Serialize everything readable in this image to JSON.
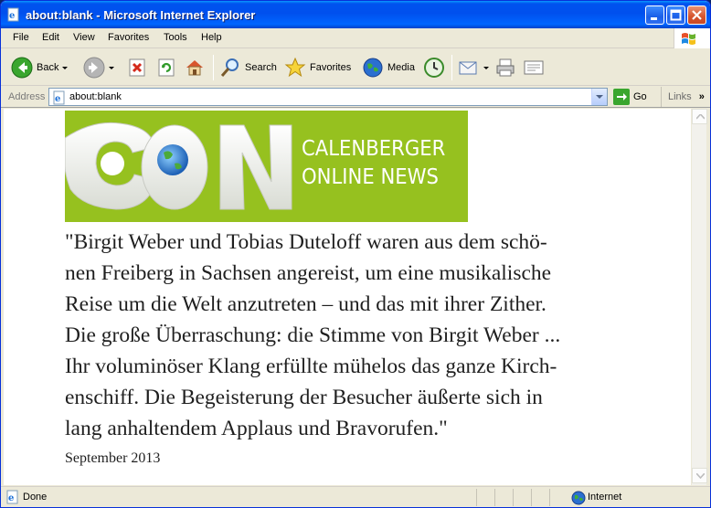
{
  "window": {
    "title": "about:blank - Microsoft Internet Explorer"
  },
  "menu": {
    "items": [
      "File",
      "Edit",
      "View",
      "Favorites",
      "Tools",
      "Help"
    ]
  },
  "toolbar": {
    "back_label": "Back",
    "search_label": "Search",
    "favorites_label": "Favorites",
    "media_label": "Media"
  },
  "address": {
    "label": "Address",
    "value": "about:blank",
    "go_label": "Go",
    "links_label": "Links"
  },
  "content": {
    "banner": {
      "line1": "CALENBERGER",
      "line2": "ONLINE NEWS",
      "brand_color": "#96c11f"
    },
    "quote_lines": [
      "\"Birgit Weber und Tobias Duteloff waren aus dem schö-",
      "nen Freiberg in Sachsen angereist, um eine musikalische",
      "Reise um die Welt anzutreten – und das mit ihrer Zither.",
      "Die große Überraschung: die Stimme von Birgit Weber ...",
      "Ihr voluminöser Klang erfüllte mühelos das ganze Kirch-",
      "enschiff. Die Begeisterung der Besucher äußerte sich in",
      "lang anhaltendem Applaus und Bravorufen.\""
    ],
    "date": "September 2013"
  },
  "status": {
    "text": "Done",
    "zone": "Internet"
  }
}
